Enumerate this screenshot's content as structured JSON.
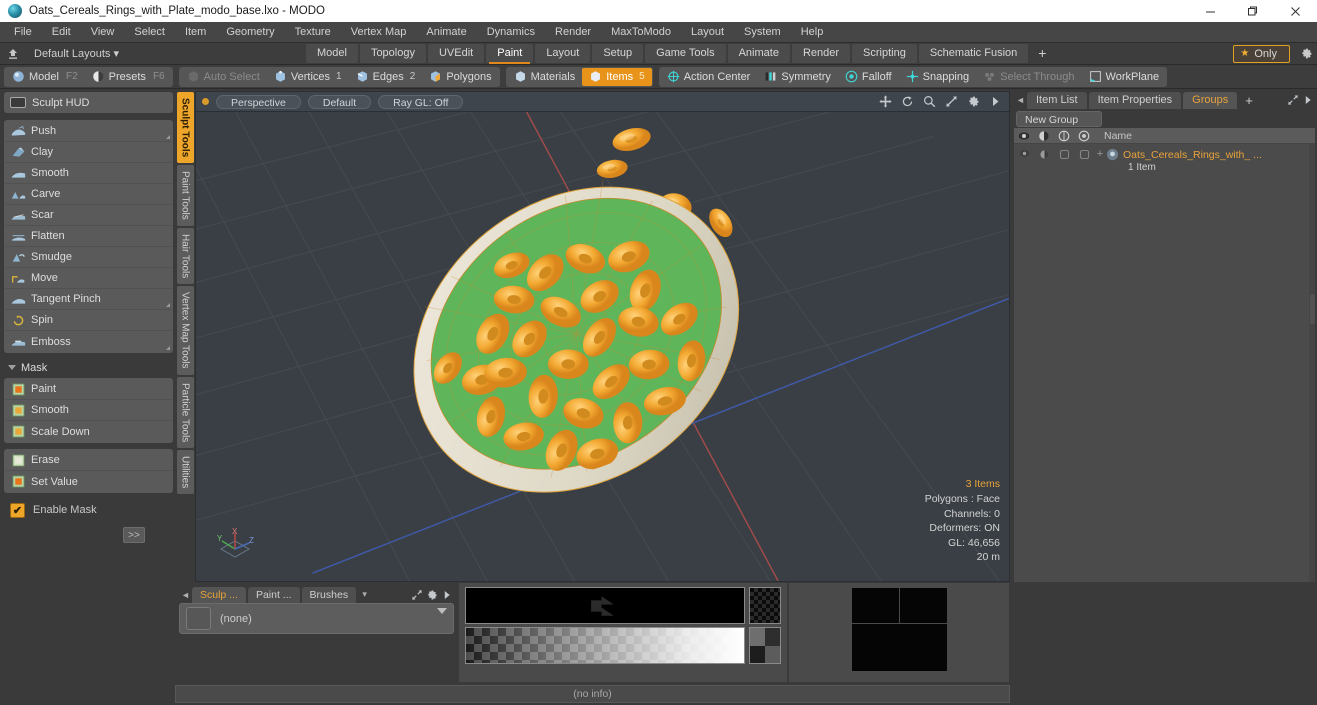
{
  "window": {
    "title": "Oats_Cereals_Rings_with_Plate_modo_base.lxo - MODO",
    "minimize": "–",
    "maximize": "❐",
    "close": "✕"
  },
  "menubar": {
    "items": [
      {
        "label": "File"
      },
      {
        "label": "Edit"
      },
      {
        "label": "View"
      },
      {
        "label": "Select"
      },
      {
        "label": "Item"
      },
      {
        "label": "Geometry"
      },
      {
        "label": "Texture"
      },
      {
        "label": "Vertex Map"
      },
      {
        "label": "Animate"
      },
      {
        "label": "Dynamics"
      },
      {
        "label": "Render"
      },
      {
        "label": "MaxToModo"
      },
      {
        "label": "Layout"
      },
      {
        "label": "System"
      },
      {
        "label": "Help"
      }
    ]
  },
  "layoutbar": {
    "default_layouts": "Default Layouts ▾",
    "tabs": [
      {
        "label": "Model",
        "active": false
      },
      {
        "label": "Topology",
        "active": false
      },
      {
        "label": "UVEdit",
        "active": false
      },
      {
        "label": "Paint",
        "active": true
      },
      {
        "label": "Layout",
        "active": false
      },
      {
        "label": "Setup",
        "active": false
      },
      {
        "label": "Game Tools",
        "active": false
      },
      {
        "label": "Animate",
        "active": false
      },
      {
        "label": "Render",
        "active": false
      },
      {
        "label": "Scripting",
        "active": false
      },
      {
        "label": "Schematic Fusion",
        "active": false
      }
    ],
    "add_tab": "+",
    "only_label": "Only",
    "star": "★"
  },
  "modebar": {
    "left_group": [
      {
        "label": "Model",
        "key": "F2",
        "icon": "sphere-icon"
      },
      {
        "label": "Presets",
        "key": "F6",
        "icon": "half-sphere-icon"
      }
    ],
    "select_group": [
      {
        "label": "Auto Select",
        "num": "",
        "state": "dim"
      },
      {
        "label": "Vertices",
        "num": "1",
        "state": "normal"
      },
      {
        "label": "Edges",
        "num": "2",
        "state": "normal"
      },
      {
        "label": "Polygons",
        "num": "",
        "state": "normal"
      }
    ],
    "items_group": [
      {
        "label": "Materials",
        "num": "",
        "state": "normal"
      },
      {
        "label": "Items",
        "num": "5",
        "state": "selected"
      }
    ],
    "right_group": [
      {
        "label": "Action Center",
        "state": "normal"
      },
      {
        "label": "Symmetry",
        "state": "normal"
      },
      {
        "label": "Falloff",
        "state": "normal"
      },
      {
        "label": "Snapping",
        "state": "normal"
      },
      {
        "label": "Select Through",
        "state": "dim"
      },
      {
        "label": "WorkPlane",
        "state": "normal"
      }
    ]
  },
  "left_panel": {
    "sculpt_hud": "Sculpt HUD",
    "tools": [
      {
        "label": "Push",
        "corner": true
      },
      {
        "label": "Clay",
        "corner": false
      },
      {
        "label": "Smooth",
        "corner": false
      },
      {
        "label": "Carve",
        "corner": false
      },
      {
        "label": "Scar",
        "corner": false
      },
      {
        "label": "Flatten",
        "corner": false
      },
      {
        "label": "Smudge",
        "corner": false
      },
      {
        "label": "Move",
        "corner": false
      },
      {
        "label": "Tangent Pinch",
        "corner": true
      },
      {
        "label": "Spin",
        "corner": false
      },
      {
        "label": "Emboss",
        "corner": true
      }
    ],
    "mask_header": "Mask",
    "mask_tools": [
      {
        "label": "Paint"
      },
      {
        "label": "Smooth"
      },
      {
        "label": "Scale Down"
      }
    ],
    "mask_tools2": [
      {
        "label": "Erase"
      },
      {
        "label": "Set Value"
      }
    ],
    "enable_mask": "Enable Mask",
    "expand": ">>",
    "vtabs": [
      {
        "label": "Sculpt Tools",
        "active": true
      },
      {
        "label": "Paint Tools",
        "active": false
      },
      {
        "label": "Hair Tools",
        "active": false
      },
      {
        "label": "Vertex Map Tools",
        "active": false
      },
      {
        "label": "Particle Tools",
        "active": false
      },
      {
        "label": "Utilities",
        "active": false
      }
    ]
  },
  "viewport": {
    "header": {
      "view_mode": "Perspective",
      "shading": "Default",
      "raygl": "Ray GL: Off",
      "icons": [
        "move-icon",
        "rotate-icon",
        "magnifier-icon",
        "fit-icon",
        "gear-icon",
        "play-icon"
      ]
    },
    "info": {
      "items": "3 Items",
      "polygons": "Polygons : Face",
      "channels": "Channels: 0",
      "deformers": "Deformers: ON",
      "gl": "GL: 46,656",
      "scale": "20 m"
    },
    "axis": {
      "x": "X",
      "y": "Y",
      "z": "Z"
    },
    "colors": {
      "background": "#393f44",
      "grid": "#454c52",
      "x_axis": "#a14b4b",
      "z_axis": "#3f5aa8",
      "cereal": "#f0a93a",
      "plate_rim": "#ddd8c8",
      "plate_inner": "#5fb55a"
    }
  },
  "right_panel": {
    "tabs": [
      {
        "label": "Item List",
        "active": false
      },
      {
        "label": "Item Properties",
        "active": false
      },
      {
        "label": "Groups",
        "active": true
      }
    ],
    "add_tab": "+",
    "new_group_button": "New Group",
    "columns": [
      {
        "name": "visibility-column",
        "icon": "eye-icon"
      },
      {
        "name": "shading-column",
        "icon": "shade-icon"
      },
      {
        "name": "wireframe-column",
        "icon": "wire-icon"
      },
      {
        "name": "render-column",
        "icon": "render-icon"
      },
      {
        "name": "name-column",
        "label": "Name"
      }
    ],
    "rows": [
      {
        "name": "Oats_Cereals_Rings_with_ ...",
        "sub": "1 Item",
        "expander": "+"
      }
    ]
  },
  "bottom_panel": {
    "tabs": [
      {
        "label": "Sculp ...",
        "active": true
      },
      {
        "label": "Paint ...",
        "active": false
      },
      {
        "label": "Brushes",
        "active": false
      }
    ],
    "dropdown_caret": "▾",
    "brush_value": "(none)",
    "status": "(no info)"
  }
}
